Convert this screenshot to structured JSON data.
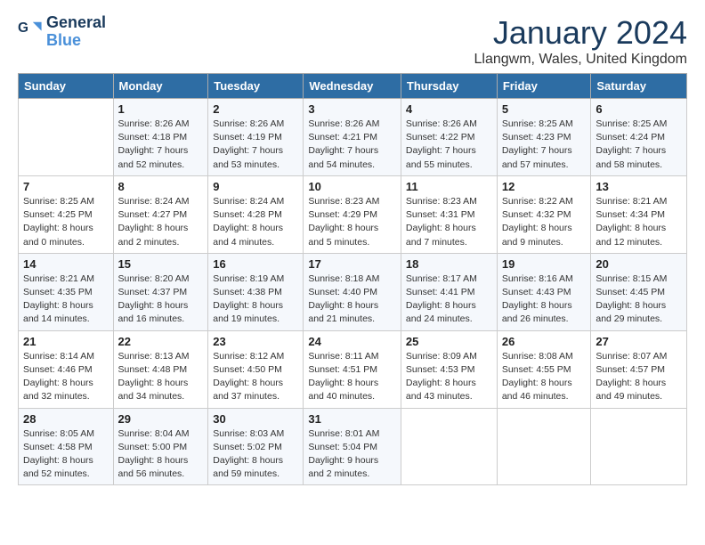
{
  "header": {
    "logo_line1": "General",
    "logo_line2": "Blue",
    "title": "January 2024",
    "subtitle": "Llangwm, Wales, United Kingdom"
  },
  "days_of_week": [
    "Sunday",
    "Monday",
    "Tuesday",
    "Wednesday",
    "Thursday",
    "Friday",
    "Saturday"
  ],
  "weeks": [
    [
      {
        "day": "",
        "info": ""
      },
      {
        "day": "1",
        "info": "Sunrise: 8:26 AM\nSunset: 4:18 PM\nDaylight: 7 hours\nand 52 minutes."
      },
      {
        "day": "2",
        "info": "Sunrise: 8:26 AM\nSunset: 4:19 PM\nDaylight: 7 hours\nand 53 minutes."
      },
      {
        "day": "3",
        "info": "Sunrise: 8:26 AM\nSunset: 4:21 PM\nDaylight: 7 hours\nand 54 minutes."
      },
      {
        "day": "4",
        "info": "Sunrise: 8:26 AM\nSunset: 4:22 PM\nDaylight: 7 hours\nand 55 minutes."
      },
      {
        "day": "5",
        "info": "Sunrise: 8:25 AM\nSunset: 4:23 PM\nDaylight: 7 hours\nand 57 minutes."
      },
      {
        "day": "6",
        "info": "Sunrise: 8:25 AM\nSunset: 4:24 PM\nDaylight: 7 hours\nand 58 minutes."
      }
    ],
    [
      {
        "day": "7",
        "info": "Sunrise: 8:25 AM\nSunset: 4:25 PM\nDaylight: 8 hours\nand 0 minutes."
      },
      {
        "day": "8",
        "info": "Sunrise: 8:24 AM\nSunset: 4:27 PM\nDaylight: 8 hours\nand 2 minutes."
      },
      {
        "day": "9",
        "info": "Sunrise: 8:24 AM\nSunset: 4:28 PM\nDaylight: 8 hours\nand 4 minutes."
      },
      {
        "day": "10",
        "info": "Sunrise: 8:23 AM\nSunset: 4:29 PM\nDaylight: 8 hours\nand 5 minutes."
      },
      {
        "day": "11",
        "info": "Sunrise: 8:23 AM\nSunset: 4:31 PM\nDaylight: 8 hours\nand 7 minutes."
      },
      {
        "day": "12",
        "info": "Sunrise: 8:22 AM\nSunset: 4:32 PM\nDaylight: 8 hours\nand 9 minutes."
      },
      {
        "day": "13",
        "info": "Sunrise: 8:21 AM\nSunset: 4:34 PM\nDaylight: 8 hours\nand 12 minutes."
      }
    ],
    [
      {
        "day": "14",
        "info": "Sunrise: 8:21 AM\nSunset: 4:35 PM\nDaylight: 8 hours\nand 14 minutes."
      },
      {
        "day": "15",
        "info": "Sunrise: 8:20 AM\nSunset: 4:37 PM\nDaylight: 8 hours\nand 16 minutes."
      },
      {
        "day": "16",
        "info": "Sunrise: 8:19 AM\nSunset: 4:38 PM\nDaylight: 8 hours\nand 19 minutes."
      },
      {
        "day": "17",
        "info": "Sunrise: 8:18 AM\nSunset: 4:40 PM\nDaylight: 8 hours\nand 21 minutes."
      },
      {
        "day": "18",
        "info": "Sunrise: 8:17 AM\nSunset: 4:41 PM\nDaylight: 8 hours\nand 24 minutes."
      },
      {
        "day": "19",
        "info": "Sunrise: 8:16 AM\nSunset: 4:43 PM\nDaylight: 8 hours\nand 26 minutes."
      },
      {
        "day": "20",
        "info": "Sunrise: 8:15 AM\nSunset: 4:45 PM\nDaylight: 8 hours\nand 29 minutes."
      }
    ],
    [
      {
        "day": "21",
        "info": "Sunrise: 8:14 AM\nSunset: 4:46 PM\nDaylight: 8 hours\nand 32 minutes."
      },
      {
        "day": "22",
        "info": "Sunrise: 8:13 AM\nSunset: 4:48 PM\nDaylight: 8 hours\nand 34 minutes."
      },
      {
        "day": "23",
        "info": "Sunrise: 8:12 AM\nSunset: 4:50 PM\nDaylight: 8 hours\nand 37 minutes."
      },
      {
        "day": "24",
        "info": "Sunrise: 8:11 AM\nSunset: 4:51 PM\nDaylight: 8 hours\nand 40 minutes."
      },
      {
        "day": "25",
        "info": "Sunrise: 8:09 AM\nSunset: 4:53 PM\nDaylight: 8 hours\nand 43 minutes."
      },
      {
        "day": "26",
        "info": "Sunrise: 8:08 AM\nSunset: 4:55 PM\nDaylight: 8 hours\nand 46 minutes."
      },
      {
        "day": "27",
        "info": "Sunrise: 8:07 AM\nSunset: 4:57 PM\nDaylight: 8 hours\nand 49 minutes."
      }
    ],
    [
      {
        "day": "28",
        "info": "Sunrise: 8:05 AM\nSunset: 4:58 PM\nDaylight: 8 hours\nand 52 minutes."
      },
      {
        "day": "29",
        "info": "Sunrise: 8:04 AM\nSunset: 5:00 PM\nDaylight: 8 hours\nand 56 minutes."
      },
      {
        "day": "30",
        "info": "Sunrise: 8:03 AM\nSunset: 5:02 PM\nDaylight: 8 hours\nand 59 minutes."
      },
      {
        "day": "31",
        "info": "Sunrise: 8:01 AM\nSunset: 5:04 PM\nDaylight: 9 hours\nand 2 minutes."
      },
      {
        "day": "",
        "info": ""
      },
      {
        "day": "",
        "info": ""
      },
      {
        "day": "",
        "info": ""
      }
    ]
  ]
}
